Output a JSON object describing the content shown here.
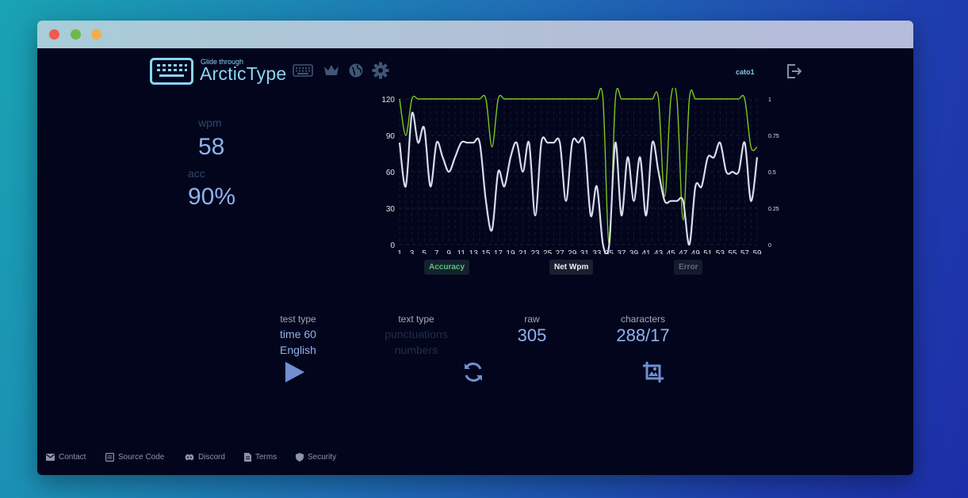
{
  "header": {
    "tagline": "Glide through",
    "brand": "ArcticType",
    "username": "cato1",
    "nav_icons": [
      "keyboard-icon",
      "crown-icon",
      "globe-icon",
      "gear-icon"
    ]
  },
  "stats": {
    "wpm_label": "wpm",
    "wpm_value": "58",
    "acc_label": "acc",
    "acc_value": "90%"
  },
  "legend": {
    "accuracy": "Accuracy",
    "net_wpm": "Net Wpm",
    "error": "Error"
  },
  "info": {
    "test_type_label": "test type",
    "test_type_value": "time 60",
    "test_language": "English",
    "text_type_label": "text type",
    "text_type_option1": "punctuations",
    "text_type_option2": "numbers",
    "raw_label": "raw",
    "raw_value": "305",
    "characters_label": "characters",
    "characters_value": "288/17"
  },
  "actions": [
    "play-icon",
    "restart-icon",
    "screenshot-icon"
  ],
  "footer": {
    "contact": "Contact",
    "source_code": "Source Code",
    "discord": "Discord",
    "terms": "Terms",
    "security": "Security"
  },
  "colors": {
    "background": "#03051c",
    "accent": "#8fb2ee",
    "brand": "#8bd4f3",
    "wpm_line": "#d8dcee",
    "accuracy_line": "#7ec81a"
  },
  "chart_data": {
    "type": "line",
    "x": [
      1,
      2,
      3,
      4,
      5,
      6,
      7,
      8,
      9,
      10,
      11,
      12,
      13,
      14,
      15,
      16,
      17,
      18,
      19,
      20,
      21,
      22,
      23,
      24,
      25,
      26,
      27,
      28,
      29,
      30,
      31,
      32,
      33,
      34,
      35,
      36,
      37,
      38,
      39,
      40,
      41,
      42,
      43,
      44,
      45,
      46,
      47,
      48,
      49,
      50,
      51,
      52,
      53,
      54,
      55,
      56,
      57,
      58,
      59
    ],
    "x_ticks": [
      "1",
      "3",
      "5",
      "7",
      "9",
      "11",
      "13",
      "15",
      "17",
      "19",
      "21",
      "23",
      "25",
      "27",
      "29",
      "31",
      "33",
      "35",
      "37",
      "39",
      "41",
      "43",
      "45",
      "47",
      "49",
      "51",
      "53",
      "55",
      "57",
      "59"
    ],
    "y_ticks": [
      "0",
      "30",
      "60",
      "90",
      "120"
    ],
    "y2_ticks": [
      "0",
      "0.25",
      "0.5",
      "0.75",
      "1"
    ],
    "ylim": [
      0,
      120
    ],
    "y2lim": [
      0,
      1
    ],
    "series": [
      {
        "name": "Net Wpm",
        "axis": "left",
        "values": [
          84,
          48,
          108,
          84,
          96,
          48,
          84,
          72,
          60,
          72,
          84,
          84,
          84,
          84,
          36,
          12,
          60,
          48,
          72,
          84,
          60,
          84,
          24,
          84,
          84,
          84,
          84,
          36,
          84,
          84,
          84,
          24,
          48,
          0,
          0,
          84,
          24,
          72,
          36,
          72,
          24,
          84,
          60,
          36,
          36,
          36,
          36,
          0,
          48,
          48,
          72,
          72,
          84,
          60,
          60,
          60,
          84,
          36,
          72
        ]
      },
      {
        "name": "Accuracy",
        "axis": "right",
        "values": [
          1,
          0.75,
          1,
          1,
          1,
          1,
          1,
          1,
          1,
          1,
          1,
          1,
          1,
          1,
          1,
          0.67,
          1,
          1,
          1,
          1,
          1,
          1,
          1,
          1,
          1,
          1,
          1,
          1,
          1,
          1,
          1,
          1,
          1,
          1,
          0,
          1,
          1,
          1,
          1,
          1,
          1,
          1,
          1,
          0.33,
          1,
          1,
          0.17,
          1,
          1,
          1,
          1,
          1,
          1,
          1,
          1,
          1,
          1,
          0.67,
          0.67
        ]
      }
    ],
    "grid": true
  }
}
